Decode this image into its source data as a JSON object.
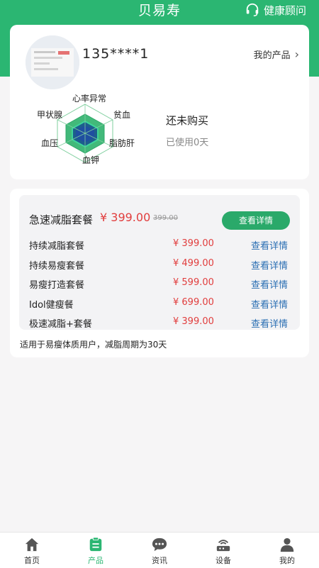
{
  "header": {
    "title": "贝易寿",
    "consult_label": "健康顾问"
  },
  "profile": {
    "phone": "135****1",
    "my_products_label": "我的产品"
  },
  "radar": {
    "labels": [
      "心率异常",
      "贫血",
      "脂肪肝",
      "血钾",
      "血压",
      "甲状腺"
    ]
  },
  "purchase_status": {
    "main": "还未购买",
    "sub": "已使用0天"
  },
  "packages": {
    "featured": {
      "name": "急速减脂套餐",
      "price": "¥ 399.00",
      "old_price": "399.00",
      "button": "查看详情"
    },
    "items": [
      {
        "name": "持续减脂套餐",
        "price": "¥ 399.00",
        "link": "查看详情"
      },
      {
        "name": "持续易瘦套餐",
        "price": "¥ 499.00",
        "link": "查看详情"
      },
      {
        "name": "易瘦打造套餐",
        "price": "¥ 599.00",
        "link": "查看详情"
      },
      {
        "name": "Idol健瘦餐",
        "price": "¥ 699.00",
        "link": "查看详情"
      },
      {
        "name": "极速减脂+套餐",
        "price": "¥ 399.00",
        "link": "查看详情"
      }
    ],
    "note": "适用于易瘦体质用户，减脂周期为30天"
  },
  "tabbar": {
    "active": 1,
    "tabs": [
      {
        "label": "首页",
        "icon": "home-icon"
      },
      {
        "label": "产品",
        "icon": "product-icon"
      },
      {
        "label": "资讯",
        "icon": "news-icon"
      },
      {
        "label": "设备",
        "icon": "device-icon"
      },
      {
        "label": "我的",
        "icon": "profile-icon"
      }
    ]
  },
  "colors": {
    "brand": "#2bb672",
    "price": "#e13d3d",
    "link": "#2b6fb3"
  }
}
